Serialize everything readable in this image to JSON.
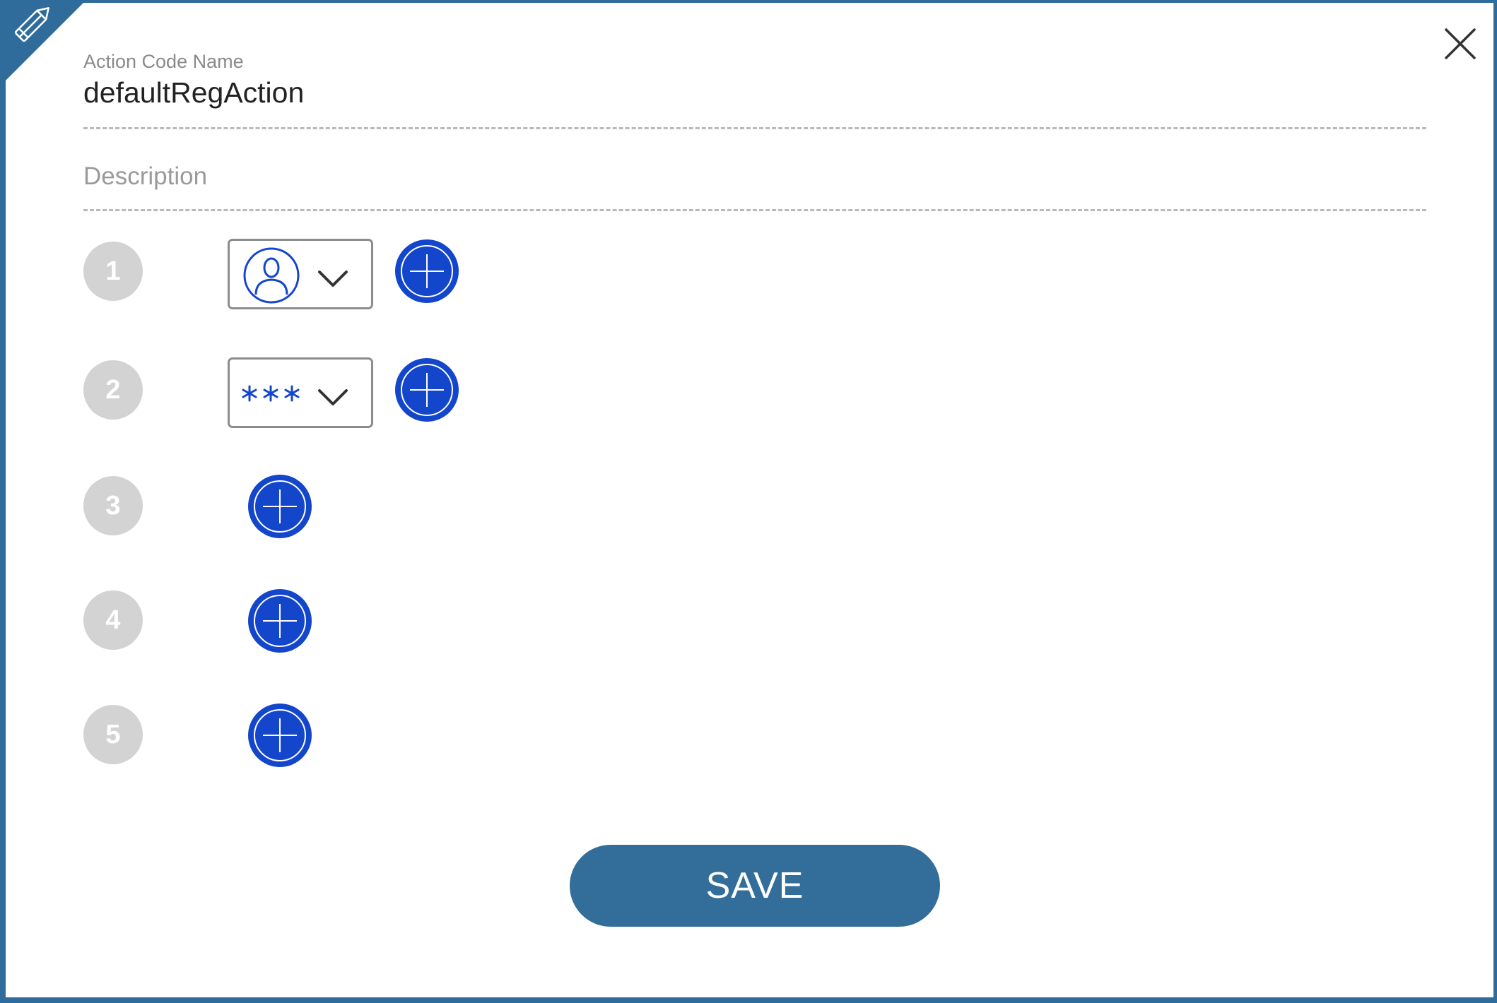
{
  "header": {
    "edit_icon": "pencil-icon",
    "close_icon": "close-icon"
  },
  "form": {
    "action_code_label": "Action Code Name",
    "action_code_value": "defaultRegAction",
    "description_placeholder": "Description",
    "description_value": ""
  },
  "steps": [
    {
      "number": "1",
      "factor": "user-profile-icon",
      "add_icon": "plus-circle-icon"
    },
    {
      "number": "2",
      "factor": "password-stars-icon",
      "add_icon": "plus-circle-icon"
    },
    {
      "number": "3",
      "factor": null,
      "add_icon": "plus-circle-icon"
    },
    {
      "number": "4",
      "factor": null,
      "add_icon": "plus-circle-icon"
    },
    {
      "number": "5",
      "factor": null,
      "add_icon": "plus-circle-icon"
    }
  ],
  "footer": {
    "save_label": "SAVE"
  },
  "colors": {
    "frame": "#2f6c9b",
    "save_button": "#336d99",
    "add_button": "#1446cc",
    "step_badge": "#d3d3d3"
  }
}
